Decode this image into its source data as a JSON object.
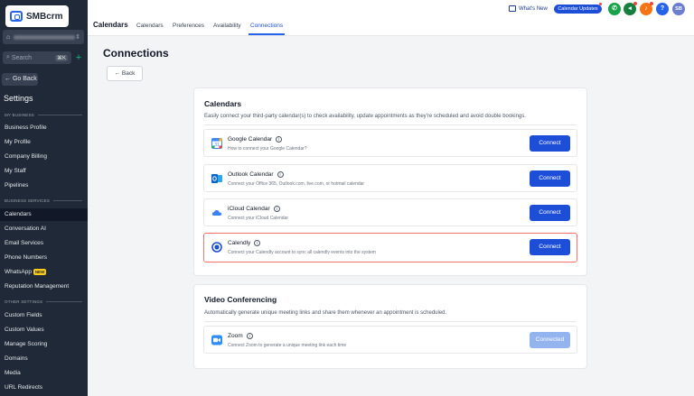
{
  "app": {
    "logo_text": "SMBcrm"
  },
  "sidebar": {
    "search_placeholder": "Search",
    "search_kbd": "⌘K",
    "go_back": "Go Back",
    "settings_title": "Settings",
    "sections": {
      "my_business": "MY BUSINESS",
      "business_services": "BUSINESS SERVICES",
      "other_settings": "OTHER SETTINGS"
    },
    "items": [
      {
        "label": "Business Profile"
      },
      {
        "label": "My Profile"
      },
      {
        "label": "Company Billing"
      },
      {
        "label": "My Staff"
      },
      {
        "label": "Pipelines"
      },
      {
        "label": "Calendars"
      },
      {
        "label": "Conversation AI"
      },
      {
        "label": "Email Services"
      },
      {
        "label": "Phone Numbers"
      },
      {
        "label": "WhatsApp",
        "badge": "NEW"
      },
      {
        "label": "Reputation Management"
      },
      {
        "label": "Custom Fields"
      },
      {
        "label": "Custom Values"
      },
      {
        "label": "Manage Scoring"
      },
      {
        "label": "Domains"
      },
      {
        "label": "Media"
      },
      {
        "label": "URL Redirects"
      }
    ],
    "active_item": "Calendars"
  },
  "topbar": {
    "title": "Calendars",
    "tabs": [
      {
        "label": "Calendars"
      },
      {
        "label": "Preferences"
      },
      {
        "label": "Availability"
      },
      {
        "label": "Connections"
      }
    ],
    "active_tab": "Connections",
    "whats_new": "What's New",
    "calendar_updates": "Calendar Updates",
    "avatar_initials": "SB",
    "help": "?",
    "colors": {
      "phone": "#16a34a",
      "megaphone": "#15803d",
      "bell": "#f97316",
      "help": "#2563eb",
      "avatar": "#6b7fcf"
    }
  },
  "main": {
    "title": "Connections",
    "back_label": "Back",
    "calendars_card": {
      "title": "Calendars",
      "subtitle": "Easily connect your third-party calendar(s) to check availability, update appointments as they're scheduled and avoid double bookings.",
      "rows": [
        {
          "name": "Google Calendar",
          "desc": "How to connect your Google Calendar?",
          "button": "Connect",
          "icon": "google-calendar-icon"
        },
        {
          "name": "Outlook Calendar",
          "desc": "Connect your Office 365, Outlook.com, live.com, or hotmail calendar",
          "button": "Connect",
          "icon": "outlook-icon"
        },
        {
          "name": "iCloud Calendar",
          "desc": "Connect your iCloud Calendar",
          "button": "Connect",
          "icon": "icloud-icon"
        },
        {
          "name": "Calendly",
          "desc": "Connect your Calendly account to sync all calendly events into the system",
          "button": "Connect",
          "icon": "calendly-icon"
        }
      ]
    },
    "video_card": {
      "title": "Video Conferencing",
      "subtitle": "Automatically generate unique meeting links and share them whenever an appointment is scheduled.",
      "rows": [
        {
          "name": "Zoom",
          "desc": "Connect Zoom to generate a unique meeting link each time",
          "button": "Connected",
          "icon": "zoom-icon"
        }
      ]
    }
  }
}
